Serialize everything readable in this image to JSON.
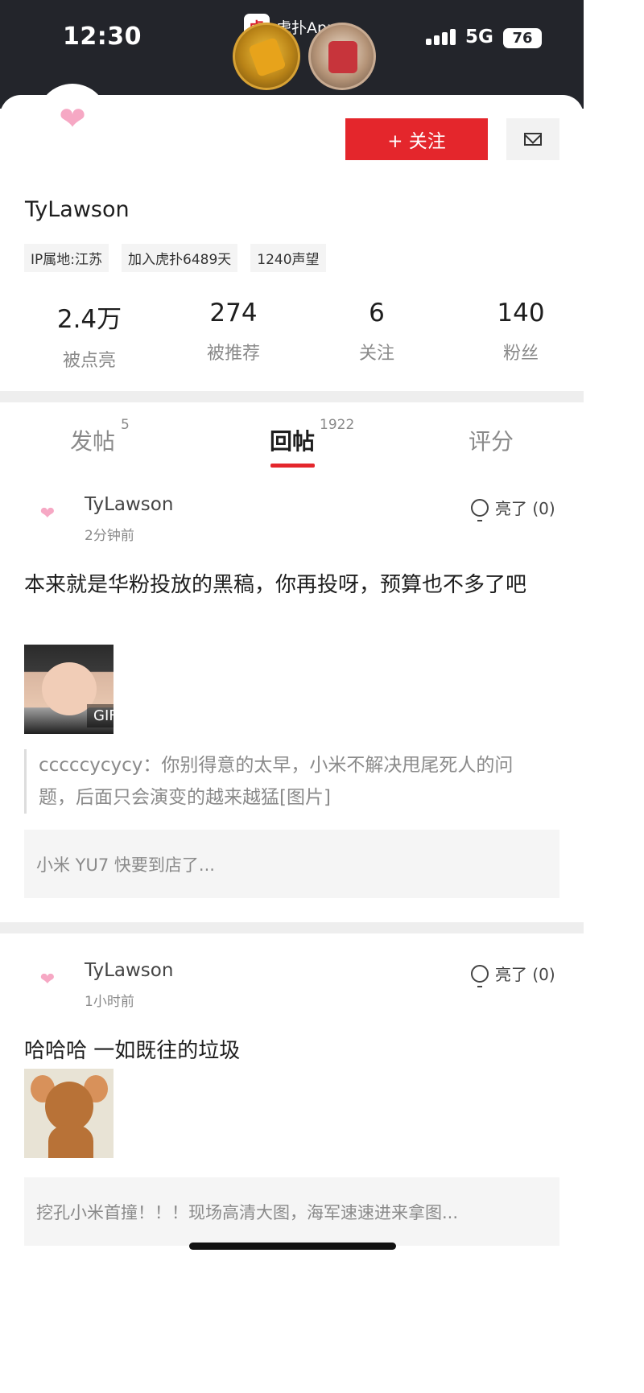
{
  "status_bar": {
    "time": "12:30",
    "app_label": "虎扑App",
    "app_logo_char": "虎",
    "network": "5G",
    "battery": "76"
  },
  "profile": {
    "username": "TyLawson",
    "follow_label": "+ 关注",
    "tags": [
      "IP属地:江苏",
      "加入虎扑6489天",
      "1240声望"
    ],
    "stats": [
      {
        "value": "2.4万",
        "label": "被点亮"
      },
      {
        "value": "274",
        "label": "被推荐"
      },
      {
        "value": "6",
        "label": "关注"
      },
      {
        "value": "140",
        "label": "粉丝"
      }
    ]
  },
  "tabs": [
    {
      "label": "发帖",
      "count": "5"
    },
    {
      "label": "回帖",
      "count": "1922"
    },
    {
      "label": "评分",
      "count": ""
    }
  ],
  "posts": [
    {
      "author": "TyLawson",
      "time": "2分钟前",
      "light_label": "亮了 (0)",
      "text": "本来就是华粉投放的黑稿，你再投呀，预算也不多了吧",
      "image_badge": "GIF",
      "quote": "cccccycycy：你别得意的太早，小米不解决甩尾死人的问题，后面只会演变的越来越猛[图片]",
      "ref_title": "小米 YU7 快要到店了..."
    },
    {
      "author": "TyLawson",
      "time": "1小时前",
      "light_label": "亮了 (0)",
      "text": "哈哈哈 一如既往的垃圾",
      "ref_title": "挖孔小米首撞！！！现场高清大图，海军速速进来拿图..."
    }
  ],
  "colors": {
    "accent": "#e4262c",
    "header_bg": "#23252b",
    "avatar_heart": "#f6a8c4"
  }
}
